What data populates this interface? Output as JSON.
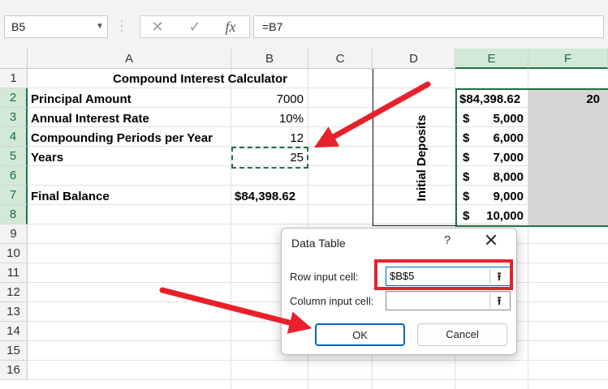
{
  "formula_bar": {
    "name_box": "B5",
    "formula": "=B7",
    "cancel_glyph": "✕",
    "enter_glyph": "✓",
    "fx_glyph": "fx"
  },
  "columns": [
    "A",
    "B",
    "C",
    "D",
    "E",
    "F"
  ],
  "rows": [
    "1",
    "2",
    "3",
    "4",
    "5",
    "6",
    "7",
    "8",
    "9",
    "10",
    "11",
    "12",
    "13",
    "14",
    "15",
    "16"
  ],
  "cells": {
    "A1": "Compound Interest Calculator",
    "A2": "Principal Amount",
    "B2": "7000",
    "A3": "Annual Interest Rate",
    "B3": "10%",
    "A4": "Compounding Periods per Year",
    "B4": "12",
    "A5": "Years",
    "B5": "25",
    "A7": "Final Balance",
    "B7": "$84,398.62",
    "D_label": "Initial Deposits",
    "E2": "$84,398.62",
    "F2": "20",
    "E3": "5,000",
    "E4": "6,000",
    "E5": "7,000",
    "E6": "8,000",
    "E7": "9,000",
    "E8": "10,000",
    "currency": "$"
  },
  "dialog": {
    "title": "Data Table",
    "help": "?",
    "close": "✕",
    "row_input_label": "Row input cell:",
    "row_input_value": "$B$5",
    "column_input_label": "Column input cell:",
    "column_input_value": "",
    "ok_label": "OK",
    "cancel_label": "Cancel"
  },
  "colors": {
    "excel_green": "#217346",
    "annotation_red": "#e8202a",
    "ok_border": "#0067c0"
  }
}
